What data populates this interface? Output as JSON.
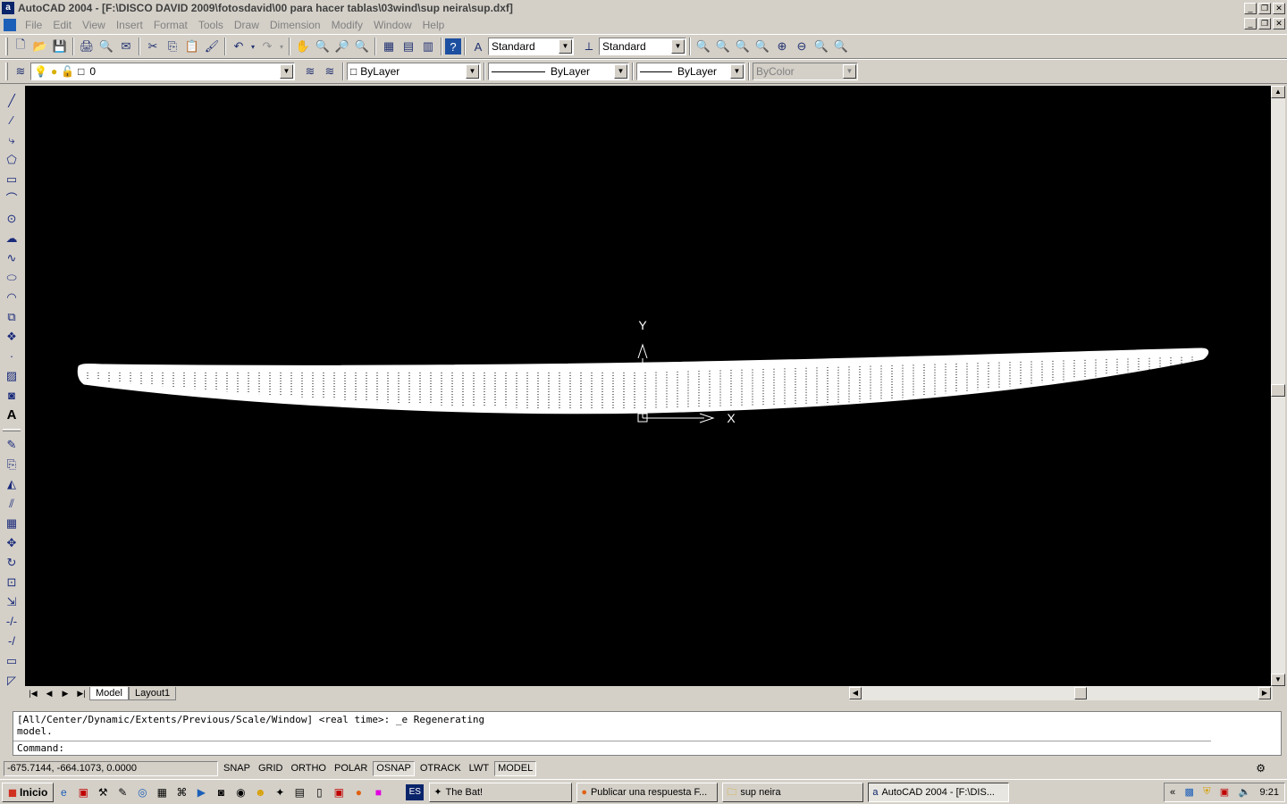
{
  "window": {
    "title": "AutoCAD 2004 - [F:\\DISCO DAVID 2009\\fotosdavid\\00 para hacer tablas\\03wind\\sup neira\\sup.dxf]"
  },
  "menu": [
    "File",
    "Edit",
    "View",
    "Insert",
    "Format",
    "Tools",
    "Draw",
    "Dimension",
    "Modify",
    "Window",
    "Help"
  ],
  "styles": {
    "text_style": "Standard",
    "dim_style": "Standard"
  },
  "layer": {
    "current": "0",
    "color": "ByLayer",
    "linetype": "ByLayer",
    "lineweight": "ByLayer",
    "plotstyle": "ByColor"
  },
  "tabs": {
    "model": "Model",
    "layout1": "Layout1"
  },
  "ucs": {
    "y": "Y",
    "x": "X"
  },
  "command": {
    "history_line1": "[All/Center/Dynamic/Extents/Previous/Scale/Window] <real time>: _e Regenerating",
    "history_line2": "model.",
    "prompt": "Command:"
  },
  "status": {
    "coords": "-675.7144, -664.1073, 0.0000",
    "buttons": [
      "SNAP",
      "GRID",
      "ORTHO",
      "POLAR",
      "OSNAP",
      "OTRACK",
      "LWT",
      "MODEL"
    ],
    "active": [
      "OSNAP",
      "MODEL"
    ]
  },
  "taskbar": {
    "start": "Inicio",
    "lang": "ES",
    "tasks": [
      "The Bat!",
      "Publicar una respuesta F...",
      "sup neira",
      "AutoCAD 2004 - [F:\\DIS..."
    ],
    "clock": "9:21"
  },
  "colors": {
    "canvas": "#000000",
    "chrome": "#d4d0c8",
    "drawing": "#ffffff"
  }
}
